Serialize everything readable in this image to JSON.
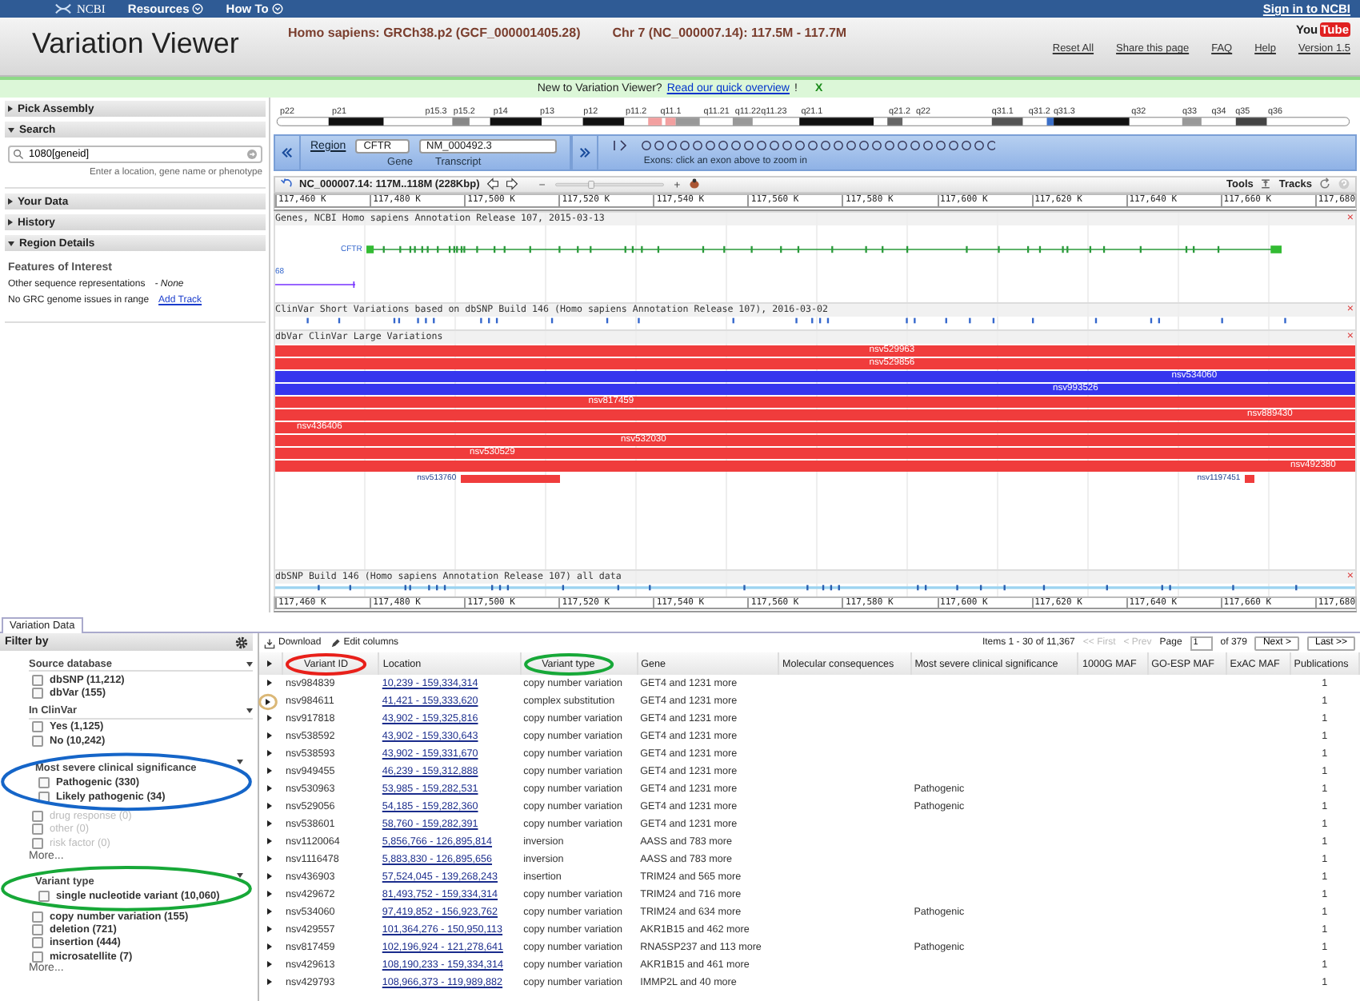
{
  "top_bar": {
    "logo": "NCBI",
    "menus": [
      {
        "label": "Resources"
      },
      {
        "label": "How To"
      }
    ],
    "sign_in": "Sign in to NCBI"
  },
  "header": {
    "title": "Variation Viewer",
    "assembly": "Homo sapiens: GRCh38.p2 (GCF_000001405.28)",
    "region": "Chr 7 (NC_000007.14): 117.5M - 117.7M",
    "youtube": [
      "You",
      "Tube"
    ],
    "links": [
      "Reset All",
      "Share this page",
      "FAQ",
      "Help",
      "Version 1.5"
    ]
  },
  "notice": {
    "text": "New to Variation Viewer?",
    "link": "Read our quick overview",
    "after": "!",
    "close": "X"
  },
  "sidebar": {
    "sections": [
      {
        "label": "Pick Assembly",
        "expanded": false
      },
      {
        "label": "Search",
        "expanded": true,
        "kind": "search",
        "value": "1080[geneid]",
        "hint": "Enter a location, gene name or phenotype"
      },
      {
        "label": "Your Data",
        "expanded": false
      },
      {
        "label": "History",
        "expanded": false
      },
      {
        "label": "Region Details",
        "expanded": true,
        "kind": "details",
        "heading": "Features of Interest",
        "other": "Other sequence representations",
        "none": "- None",
        "grc": "No GRC genome issues in range",
        "add": "Add Track"
      }
    ]
  },
  "viewer": {
    "bands": [
      "p22",
      "p21",
      "p15.3",
      "p15.2",
      "p14",
      "p13",
      "p12",
      "p11.2",
      "q11.1",
      "q11.21",
      "q11.22",
      "q11.23",
      "q21.1",
      "q21.2",
      "q22",
      "q31.1",
      "q31.2",
      "q31.3",
      "q32",
      "q33",
      "q34",
      "q35",
      "q36"
    ],
    "region_bar": {
      "label": "Region",
      "gene": "CFTR",
      "transcript": "NM_000492.3",
      "gene_caption": "Gene",
      "transcript_caption": "Transcript",
      "exon_hint": "Exons: click an exon above to zoom in"
    },
    "toolbar": {
      "location": "NC_000007.14: 117M..118M (228Kbp)",
      "tools": "Tools",
      "tracks": "Tracks",
      "zoom": {
        "level": 0.33
      }
    },
    "ruler": [
      "117,460 K",
      "117,480 K",
      "117,500 K",
      "117,520 K",
      "117,540 K",
      "117,560 K",
      "117,580 K",
      "117,600 K",
      "117,620 K",
      "117,640 K",
      "117,660 K",
      "117,680"
    ],
    "tracks": [
      {
        "kind": "genes",
        "title": "Genes, NCBI Homo sapiens Annotation Release 107, 2015-03-13",
        "close": "×",
        "gene": "CFTR",
        "other_gene": "68"
      },
      {
        "kind": "clinvar",
        "title": "ClinVar Short Variations based on dbSNP Build 146 (Homo sapiens Annotation Release 107), 2016-03-02",
        "close": "×"
      },
      {
        "kind": "dbvar",
        "title": "dbVar ClinVar Large Variations",
        "close": "×",
        "bars": [
          {
            "label": "nsv529963",
            "color": "#f03c3c",
            "kind": "full"
          },
          {
            "label": "nsv529856",
            "color": "#f03c3c",
            "kind": "full"
          },
          {
            "label": "nsv534060",
            "color": "#3636ee",
            "kind": "full"
          },
          {
            "label": "nsv993526",
            "color": "#3636ee",
            "kind": "full"
          },
          {
            "label": "nsv817459",
            "color": "#f03c3c",
            "kind": "full"
          },
          {
            "label": "nsv889430",
            "color": "#f03c3c",
            "kind": "full"
          },
          {
            "label": "nsv436406",
            "color": "#f03c3c",
            "kind": "full"
          },
          {
            "label": "nsv532030",
            "color": "#f03c3c",
            "kind": "full"
          },
          {
            "label": "nsv530529",
            "color": "#f03c3c",
            "kind": "full"
          },
          {
            "label": "nsv492380",
            "color": "#f03c3c",
            "kind": "full"
          },
          {
            "label": "nsv513760",
            "color": "#f03c3c",
            "kind": "partial"
          },
          {
            "label": "nsv1197451",
            "color": "#f03c3c",
            "kind": "partial"
          }
        ]
      },
      {
        "kind": "dbsnp",
        "title": "dbSNP Build 146 (Homo sapiens Annotation Release 107) all data",
        "close": "×"
      }
    ],
    "bottom_ruler": [
      "117,460 K",
      "117,480 K",
      "117,500 K",
      "117,520 K",
      "117,540 K",
      "117,560 K",
      "117,580 K",
      "117,600 K",
      "117,620 K",
      "117,640 K",
      "117,660 K",
      "117,680"
    ]
  },
  "data_tabs": [
    {
      "label": "Variation Data",
      "selected": true
    }
  ],
  "filter": {
    "title": "Filter by",
    "groups": [
      {
        "title": "Source database",
        "items": [
          {
            "label": "dbSNP (11,212)",
            "checked": false,
            "disabled": false
          },
          {
            "label": "dbVar (155)",
            "checked": false,
            "disabled": false
          }
        ]
      },
      {
        "title": "In ClinVar",
        "items": [
          {
            "label": "Yes (1,125)",
            "checked": false,
            "disabled": false
          },
          {
            "label": "No (10,242)",
            "checked": false,
            "disabled": false
          }
        ]
      },
      {
        "title": "Most severe clinical significance",
        "color": "#1565c8",
        "items": [
          {
            "label": "Pathogenic (330)",
            "checked": false,
            "disabled": false,
            "circled": true
          },
          {
            "label": "Likely pathogenic (34)",
            "checked": false,
            "disabled": false,
            "circled": true
          },
          {
            "label": "drug response (0)",
            "checked": false,
            "disabled": true,
            "circled": false
          },
          {
            "label": "other (0)",
            "checked": false,
            "disabled": true,
            "circled": false
          },
          {
            "label": "risk factor (0)",
            "checked": false,
            "disabled": true,
            "circled": false
          }
        ],
        "more": "More..."
      },
      {
        "title": "Variant type",
        "color": "#17a838",
        "items": [
          {
            "label": "single nucleotide variant (10,060)",
            "checked": false,
            "disabled": false,
            "circled": true
          },
          {
            "label": "copy number variation (155)",
            "checked": false,
            "disabled": false,
            "circled": false
          },
          {
            "label": "deletion (721)",
            "checked": false,
            "disabled": false,
            "circled": false
          },
          {
            "label": "insertion (444)",
            "checked": false,
            "disabled": false,
            "circled": false
          },
          {
            "label": "microsatellite (7)",
            "checked": false,
            "disabled": false,
            "circled": false
          }
        ],
        "more": "More..."
      }
    ]
  },
  "table": {
    "actions": [
      "Download",
      "Edit columns"
    ],
    "pager": {
      "items": "Items 1 - 30 of 11,367",
      "first": {
        "label": "<< First",
        "disabled": true
      },
      "prev": {
        "label": "< Prev",
        "disabled": true
      },
      "page_label": "Page",
      "page": "1",
      "of": "of 379",
      "next": {
        "label": "Next >",
        "disabled": false
      },
      "last": {
        "label": "Last >>",
        "disabled": false
      }
    },
    "columns": [
      {
        "label": "Variant ID",
        "color": "#e8201a"
      },
      {
        "label": "Location"
      },
      {
        "label": "Variant type",
        "color": "#17a838"
      },
      {
        "label": "Gene"
      },
      {
        "label": "Molecular consequences"
      },
      {
        "label": "Most severe clinical significance"
      },
      {
        "label": "1000G MAF"
      },
      {
        "label": "GO-ESP MAF"
      },
      {
        "label": "ExAC MAF"
      },
      {
        "label": "Publications"
      }
    ],
    "rows": [
      {
        "id": "nsv984839",
        "location": "10,239 - 159,334,314",
        "type": "copy number variation",
        "gene": "GET4 and 1231 more",
        "publications": "1"
      },
      {
        "id": "nsv984611",
        "location": "41,421 - 159,333,620",
        "type": "complex substitution",
        "gene": "GET4 and 1231 more",
        "publications": "1",
        "color": "#dbb877"
      },
      {
        "id": "nsv917818",
        "location": "43,902 - 159,325,816",
        "type": "copy number variation",
        "gene": "GET4 and 1231 more",
        "publications": "1"
      },
      {
        "id": "nsv538592",
        "location": "43,902 - 159,330,643",
        "type": "copy number variation",
        "gene": "GET4 and 1231 more",
        "publications": "1"
      },
      {
        "id": "nsv538593",
        "location": "43,902 - 159,331,670",
        "type": "copy number variation",
        "gene": "GET4 and 1231 more",
        "publications": "1"
      },
      {
        "id": "nsv949455",
        "location": "46,239 - 159,312,888",
        "type": "copy number variation",
        "gene": "GET4 and 1231 more",
        "publications": "1"
      },
      {
        "id": "nsv530963",
        "location": "53,985 - 159,282,531",
        "type": "copy number variation",
        "gene": "GET4 and 1231 more",
        "significance": "Pathogenic",
        "publications": "1"
      },
      {
        "id": "nsv529056",
        "location": "54,185 - 159,282,360",
        "type": "copy number variation",
        "gene": "GET4 and 1231 more",
        "significance": "Pathogenic",
        "publications": "1"
      },
      {
        "id": "nsv538601",
        "location": "58,760 - 159,282,391",
        "type": "copy number variation",
        "gene": "GET4 and 1231 more",
        "publications": "1"
      },
      {
        "id": "nsv1120064",
        "location": "5,856,766 - 126,895,814",
        "type": "inversion",
        "gene": "AASS and 783 more",
        "publications": "1"
      },
      {
        "id": "nsv1116478",
        "location": "5,883,830 - 126,895,656",
        "type": "inversion",
        "gene": "AASS and 783 more",
        "publications": "1"
      },
      {
        "id": "nsv436903",
        "location": "57,524,045 - 139,268,243",
        "type": "insertion",
        "gene": "TRIM24 and 565 more",
        "publications": "1"
      },
      {
        "id": "nsv429672",
        "location": "81,493,752 - 159,334,314",
        "type": "copy number variation",
        "gene": "TRIM24 and 716 more",
        "publications": "1"
      },
      {
        "id": "nsv534060",
        "location": "97,419,852 - 156,923,762",
        "type": "copy number variation",
        "gene": "TRIM24 and 634 more",
        "significance": "Pathogenic",
        "publications": "1"
      },
      {
        "id": "nsv429557",
        "location": "101,364,276 - 150,950,113",
        "type": "copy number variation",
        "gene": "AKR1B15 and 462 more",
        "publications": "1"
      },
      {
        "id": "nsv817459",
        "location": "102,196,924 - 121,278,641",
        "type": "copy number variation",
        "gene": "RNA5SP237 and 113 more",
        "significance": "Pathogenic",
        "publications": "1"
      },
      {
        "id": "nsv429613",
        "location": "108,190,233 - 159,334,314",
        "type": "copy number variation",
        "gene": "AKR1B15 and 461 more",
        "publications": "1"
      },
      {
        "id": "nsv429793",
        "location": "108,966,373 - 119,989,882",
        "type": "copy number variation",
        "gene": "IMMP2L and 40 more",
        "publications": "1"
      }
    ]
  }
}
